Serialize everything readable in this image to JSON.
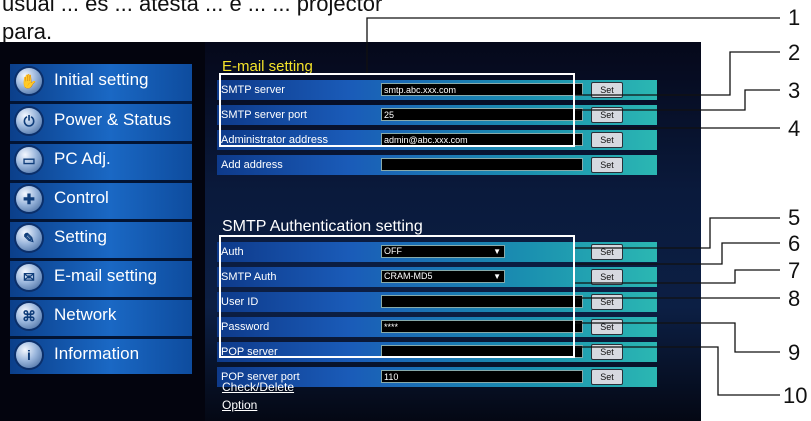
{
  "intro_text": [
    "usual ... es ... atesta ... e ... ... projector",
    "para."
  ],
  "sidebar": {
    "items": [
      {
        "label": "Initial setting",
        "icon": "hand-icon"
      },
      {
        "label": "Power & Status",
        "icon": "power-icon"
      },
      {
        "label": "PC Adj.",
        "icon": "monitor-icon"
      },
      {
        "label": "Control",
        "icon": "dpad-icon"
      },
      {
        "label": "Setting",
        "icon": "wrench-icon"
      },
      {
        "label": "E-mail setting",
        "icon": "envelope-icon"
      },
      {
        "label": "Network",
        "icon": "network-icon"
      },
      {
        "label": "Information",
        "icon": "info-icon"
      }
    ]
  },
  "email": {
    "title": "E-mail setting",
    "rows": [
      {
        "label": "SMTP server",
        "value": "smtp.abc.xxx.com",
        "set": "Set"
      },
      {
        "label": "SMTP server port",
        "value": "25",
        "set": "Set"
      },
      {
        "label": "Administrator address",
        "value": "admin@abc.xxx.com",
        "set": "Set"
      },
      {
        "label": "Add address",
        "value": "",
        "set": "Set"
      }
    ]
  },
  "auth": {
    "title": "SMTP Authentication setting",
    "rows": [
      {
        "label": "Auth",
        "value": "OFF",
        "type": "select",
        "set": "Set"
      },
      {
        "label": "SMTP Auth",
        "value": "CRAM-MD5",
        "type": "select",
        "set": "Set"
      },
      {
        "label": "User ID",
        "value": "",
        "type": "input",
        "set": "Set"
      },
      {
        "label": "Password",
        "value": "****",
        "type": "input",
        "set": "Set"
      },
      {
        "label": "POP server",
        "value": "",
        "type": "input",
        "set": "Set"
      },
      {
        "label": "POP server port",
        "value": "110",
        "type": "input",
        "set": "Set"
      }
    ]
  },
  "links": {
    "check_delete": "Check/Delete",
    "option": "Option"
  },
  "callouts": [
    "1",
    "2",
    "3",
    "4",
    "5",
    "6",
    "7",
    "8",
    "9",
    "10"
  ],
  "colors": {
    "panel_bg": "#03040e",
    "sidebar_blue": "#1a68c4",
    "title_yellow": "#f4e22a",
    "row_cyan": "#2bb7b2"
  }
}
